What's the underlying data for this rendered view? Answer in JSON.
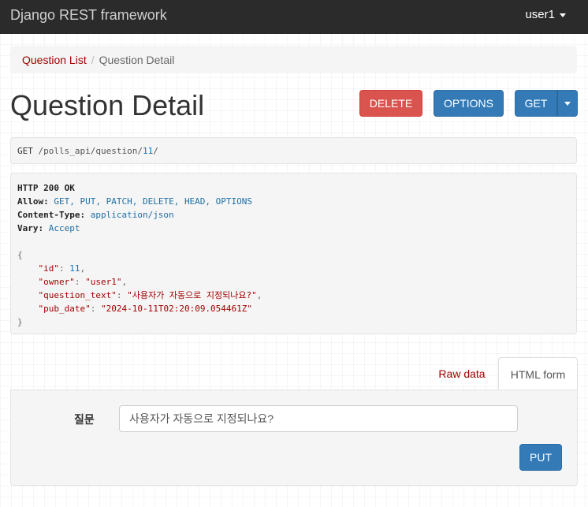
{
  "navbar": {
    "brand": "Django REST framework",
    "user": "user1"
  },
  "breadcrumb": {
    "parent": "Question List",
    "current": "Question Detail"
  },
  "page": {
    "title": "Question Detail"
  },
  "actions": {
    "delete": "DELETE",
    "options": "OPTIONS",
    "get": "GET"
  },
  "request": {
    "method": "GET",
    "path_prefix": " /polls_api/question/",
    "path_id": "11",
    "path_suffix": "/"
  },
  "response": {
    "status": "HTTP 200 OK",
    "headers": [
      {
        "name": "Allow:",
        "value": "GET, PUT, PATCH, DELETE, HEAD, OPTIONS"
      },
      {
        "name": "Content-Type:",
        "value": "application/json"
      },
      {
        "name": "Vary:",
        "value": "Accept"
      }
    ],
    "body": {
      "open": "{",
      "close": "}",
      "id_key": "\"id\"",
      "id_value": "11",
      "owner_key": "\"owner\"",
      "owner_value": "\"user1\"",
      "question_text_key": "\"question_text\"",
      "question_text_value": "\"사용자가 자동으로 지정되나요?\"",
      "pub_date_key": "\"pub_date\"",
      "pub_date_value": "\"2024-10-11T02:20:09.054461Z\""
    }
  },
  "tabs": {
    "raw": "Raw data",
    "html": "HTML form"
  },
  "form": {
    "label": "질문",
    "value": "사용자가 자동으로 지정되나요?",
    "submit": "PUT"
  },
  "colors": {
    "navbar": "#2b2b2b",
    "link": "#a30000",
    "primary": "#337ab7",
    "danger": "#d9534f"
  }
}
